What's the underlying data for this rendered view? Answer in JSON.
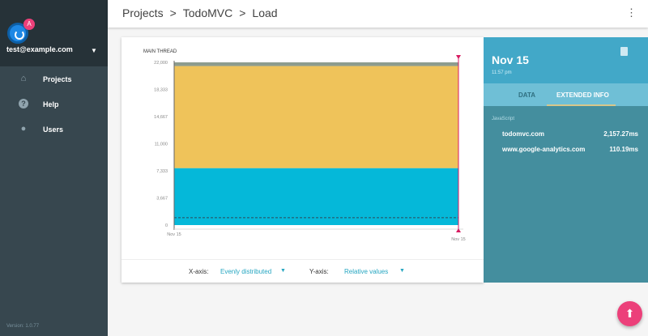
{
  "sidebar": {
    "user_email": "test@example.com",
    "badge": "A",
    "items": [
      {
        "label": "Projects",
        "icon": "home-icon"
      },
      {
        "label": "Help",
        "icon": "help-icon"
      },
      {
        "label": "Users",
        "icon": "user-icon"
      }
    ],
    "version": "Version: 1.0.77"
  },
  "header": {
    "breadcrumb": [
      "Projects",
      ">",
      "TodoMVC",
      ">",
      "Load"
    ],
    "more": "⋮"
  },
  "footer": {
    "x_label": "X-axis:",
    "x_value": "Evenly distributed",
    "y_label": "Y-axis:",
    "y_value": "Relative values"
  },
  "panel": {
    "date": "Nov 15",
    "time": "11:57 pm",
    "tabs": [
      "DATA",
      "EXTENDED INFO"
    ],
    "section": "JavaScript",
    "rows": [
      {
        "name": "todomvc.com",
        "value": "2,157.27ms"
      },
      {
        "name": "www.google-analytics.com",
        "value": "110.19ms"
      }
    ]
  },
  "chart_data": {
    "type": "area",
    "title": "MAIN THREAD",
    "categories": [
      "Nov 15",
      "Nov 15"
    ],
    "yticks": [
      "0",
      "3,667",
      "7,333",
      "11,000",
      "14,667",
      "18,333",
      "22,000"
    ],
    "ylim": [
      0,
      22000
    ],
    "series": [
      {
        "name": "cyan",
        "color": "#05b8d9",
        "values": [
          7700,
          7700
        ]
      },
      {
        "name": "yellow",
        "color": "#efc35a",
        "values": [
          13800,
          13800
        ]
      },
      {
        "name": "gray",
        "color": "#8d9c8e",
        "values": [
          500,
          500
        ]
      }
    ],
    "dashed_line": 1000
  }
}
